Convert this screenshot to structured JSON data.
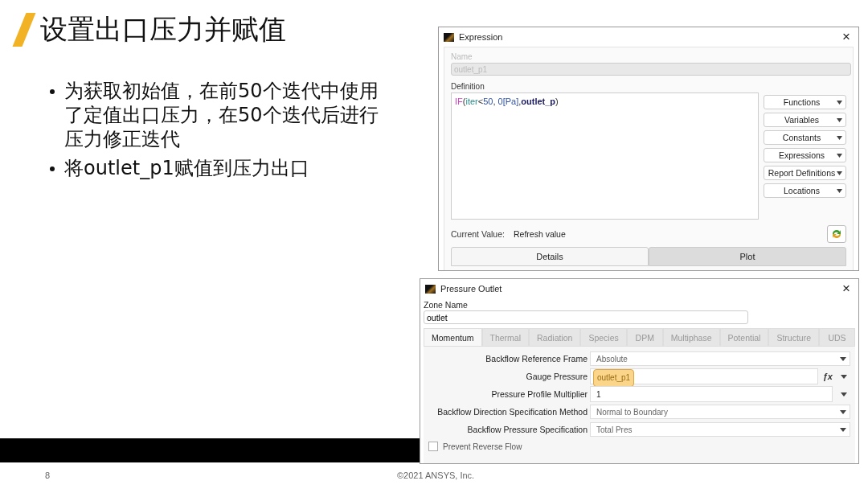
{
  "slide": {
    "title": "设置出口压力并赋值",
    "bullets": [
      "为获取初始值，在前50个迭代中使用了定值出口压力，在50个迭代后进行压力修正迭代",
      "将outlet_p1赋值到压力出口"
    ],
    "page_number": "8",
    "copyright": "©2021 ANSYS, Inc."
  },
  "expression_dialog": {
    "title": "Expression",
    "close": "×",
    "name_label": "Name",
    "name_value": "outlet_p1",
    "name_disabled": true,
    "definition_label": "Definition",
    "definition_tokens": [
      {
        "text": "IF",
        "kind": "function"
      },
      {
        "text": "(",
        "kind": "punct"
      },
      {
        "text": "iter",
        "kind": "keyword"
      },
      {
        "text": "<",
        "kind": "punct"
      },
      {
        "text": "50",
        "kind": "number"
      },
      {
        "text": ", ",
        "kind": "punct"
      },
      {
        "text": "0",
        "kind": "number"
      },
      {
        "text": "[Pa]",
        "kind": "unit"
      },
      {
        "text": ",",
        "kind": "punct"
      },
      {
        "text": "outlet_p",
        "kind": "variable"
      },
      {
        "text": ")",
        "kind": "punct"
      }
    ],
    "menu_buttons": [
      "Functions",
      "Variables",
      "Constants",
      "Expressions",
      "Report Definitions",
      "Locations"
    ],
    "current_value_label": "Current Value:",
    "current_value": "Refresh value",
    "tabs": [
      {
        "label": "Details",
        "selected": true
      },
      {
        "label": "Plot",
        "selected": false
      }
    ]
  },
  "pressure_outlet_dialog": {
    "title": "Pressure Outlet",
    "close": "×",
    "zone_name_label": "Zone Name",
    "zone_name_value": "outlet",
    "tabs": [
      {
        "label": "Momentum",
        "selected": true
      },
      {
        "label": "Thermal",
        "selected": false
      },
      {
        "label": "Radiation",
        "selected": false
      },
      {
        "label": "Species",
        "selected": false
      },
      {
        "label": "DPM",
        "selected": false
      },
      {
        "label": "Multiphase",
        "selected": false
      },
      {
        "label": "Potential",
        "selected": false
      },
      {
        "label": "Structure",
        "selected": false
      },
      {
        "label": "UDS",
        "selected": false
      }
    ],
    "fields": [
      {
        "label": "Backflow Reference Frame",
        "value": "Absolute",
        "kind": "dropdown",
        "highlighted": false
      },
      {
        "label": "Gauge Pressure",
        "value": "outlet_p1",
        "kind": "expression",
        "highlighted": true,
        "button": "ƒx"
      },
      {
        "label": "Pressure Profile Multiplier",
        "value": "1",
        "kind": "input",
        "highlighted": false
      },
      {
        "label": "Backflow Direction Specification Method",
        "value": "Normal to Boundary",
        "kind": "dropdown",
        "highlighted": false
      },
      {
        "label": "Backflow Pressure Specification",
        "value": "Total Pres",
        "kind": "dropdown",
        "highlighted": false
      }
    ],
    "checkbox": {
      "label": "Prevent Reverse Flow",
      "checked": false
    }
  }
}
